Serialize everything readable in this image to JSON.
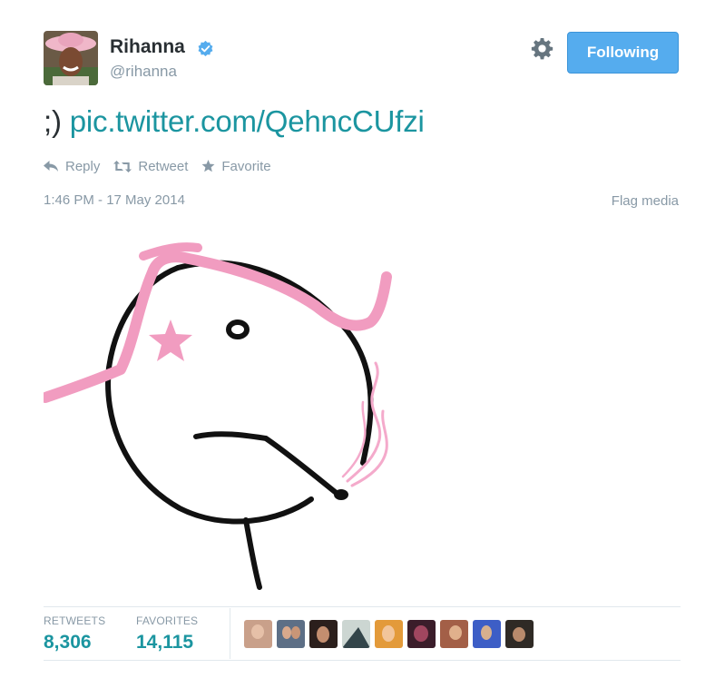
{
  "user": {
    "name": "Rihanna",
    "handle": "@rihanna",
    "verified": true
  },
  "follow_button": {
    "label": "Following"
  },
  "tweet": {
    "prefix": ";)",
    "link_text": "pic.twitter.com/QehncCUfzi"
  },
  "actions": {
    "reply": "Reply",
    "retweet": "Retweet",
    "favorite": "Favorite"
  },
  "meta": {
    "timestamp": "1:46 PM - 17 May 2014",
    "flag_label": "Flag media"
  },
  "stats": {
    "retweets_label": "RETWEETS",
    "retweets_value": "8,306",
    "favorites_label": "FAVORITES",
    "favorites_value": "14,115"
  },
  "colors": {
    "accent_link": "#1b95a0",
    "button_blue": "#55acee",
    "muted": "#8899a6",
    "drawing_pink": "#f19cc0"
  },
  "icons": [
    "verified-badge-icon",
    "gear-icon",
    "reply-icon",
    "retweet-icon",
    "star-icon"
  ]
}
